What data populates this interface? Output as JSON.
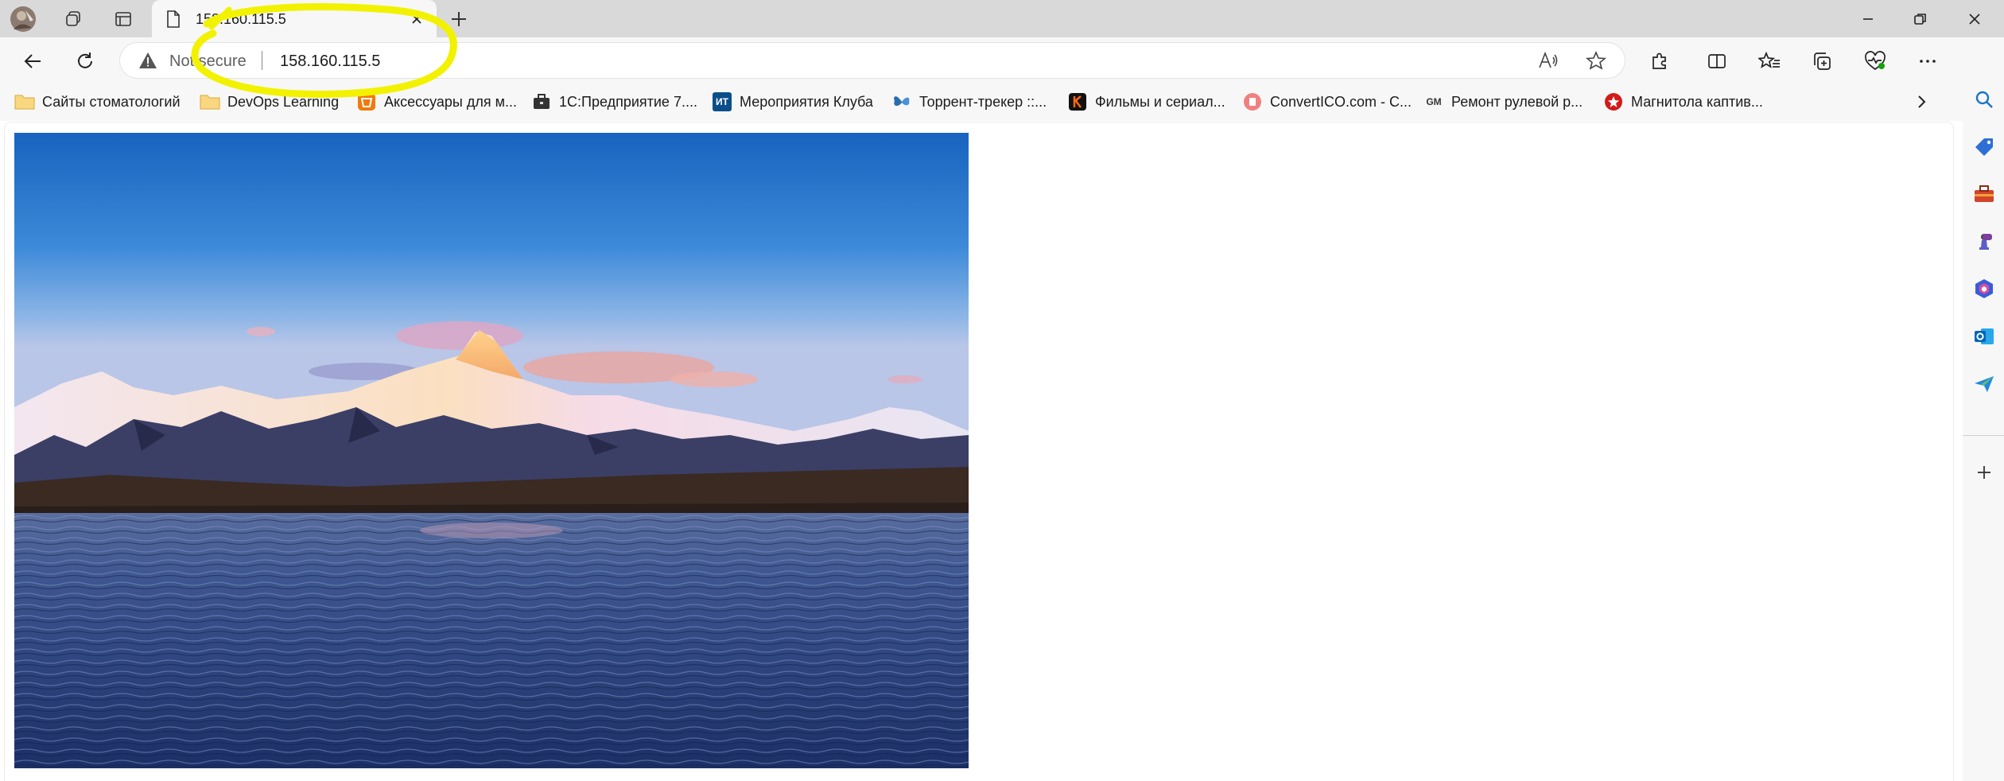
{
  "tabs": {
    "active": {
      "title": "158.160.115.5"
    }
  },
  "toolbar": {
    "security_label": "Not secure",
    "url": "158.160.115.5"
  },
  "bookmarks": [
    {
      "label": "Сайты стоматологий",
      "icon": "folder-icon"
    },
    {
      "label": "DevOps Learning",
      "icon": "folder-icon"
    },
    {
      "label": "Аксессуары для м...",
      "icon": "store-icon"
    },
    {
      "label": "1С:Предприятие 7....",
      "icon": "briefcase-icon"
    },
    {
      "label": "Мероприятия Клуба",
      "icon": "it-club-icon",
      "icon_text": "ИТ"
    },
    {
      "label": "Торрент-трекер ::...",
      "icon": "butterfly-icon"
    },
    {
      "label": "Фильмы и сериал...",
      "icon": "film-icon"
    },
    {
      "label": "ConvertICO.com - C...",
      "icon": "converter-icon"
    },
    {
      "label": "Ремонт рулевой р...",
      "icon": "gm-city-icon",
      "icon_text": "GM"
    },
    {
      "label": "Магнитола каптив...",
      "icon": "star-badge-icon"
    }
  ],
  "colors": {
    "tabstrip": "#d9d9d9",
    "toolbar": "#f7f7f7",
    "highlight": "#f2f200",
    "accent": "#0f6cbd"
  }
}
